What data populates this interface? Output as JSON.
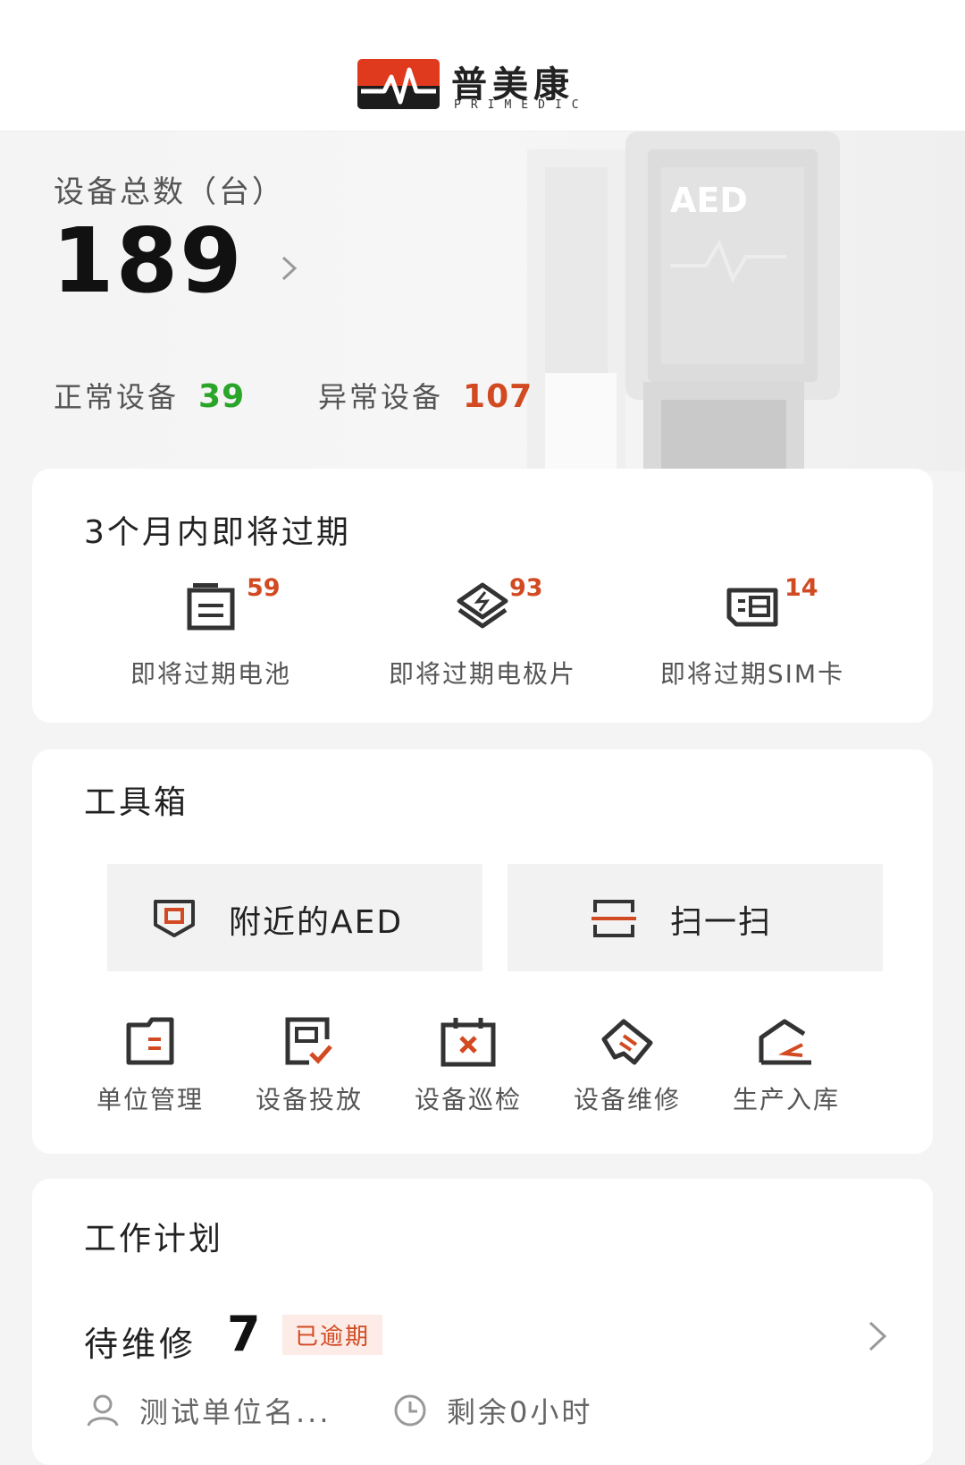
{
  "header": {
    "brand_cn": "普美康",
    "brand_en": "PRIMEDIC"
  },
  "hero": {
    "total_label": "设备总数（台）",
    "total_value": "189",
    "normal_label": "正常设备",
    "normal_value": "39",
    "abnormal_label": "异常设备",
    "abnormal_value": "107",
    "art_text": "AED"
  },
  "expiring": {
    "title": "3个月内即将过期",
    "items": [
      {
        "label": "即将过期电池",
        "count": "59",
        "icon": "battery-icon"
      },
      {
        "label": "即将过期电极片",
        "count": "93",
        "icon": "electrode-pad-icon"
      },
      {
        "label": "即将过期SIM卡",
        "count": "14",
        "icon": "sim-card-icon"
      }
    ]
  },
  "toolbox": {
    "title": "工具箱",
    "nearby_label": "附近的AED",
    "scan_label": "扫一扫",
    "items": [
      {
        "label": "单位管理",
        "icon": "unit-management-icon"
      },
      {
        "label": "设备投放",
        "icon": "device-deploy-icon"
      },
      {
        "label": "设备巡检",
        "icon": "device-inspection-icon"
      },
      {
        "label": "设备维修",
        "icon": "device-repair-icon"
      },
      {
        "label": "生产入库",
        "icon": "warehouse-in-icon"
      }
    ]
  },
  "plan": {
    "title": "工作计划",
    "row": {
      "name": "待维修",
      "count": "7",
      "badge": "已逾期",
      "unit": "测试单位名...",
      "remaining": "剩余0小时"
    }
  },
  "colors": {
    "accent_red": "#d24a22",
    "normal_green": "#2aa52a"
  }
}
